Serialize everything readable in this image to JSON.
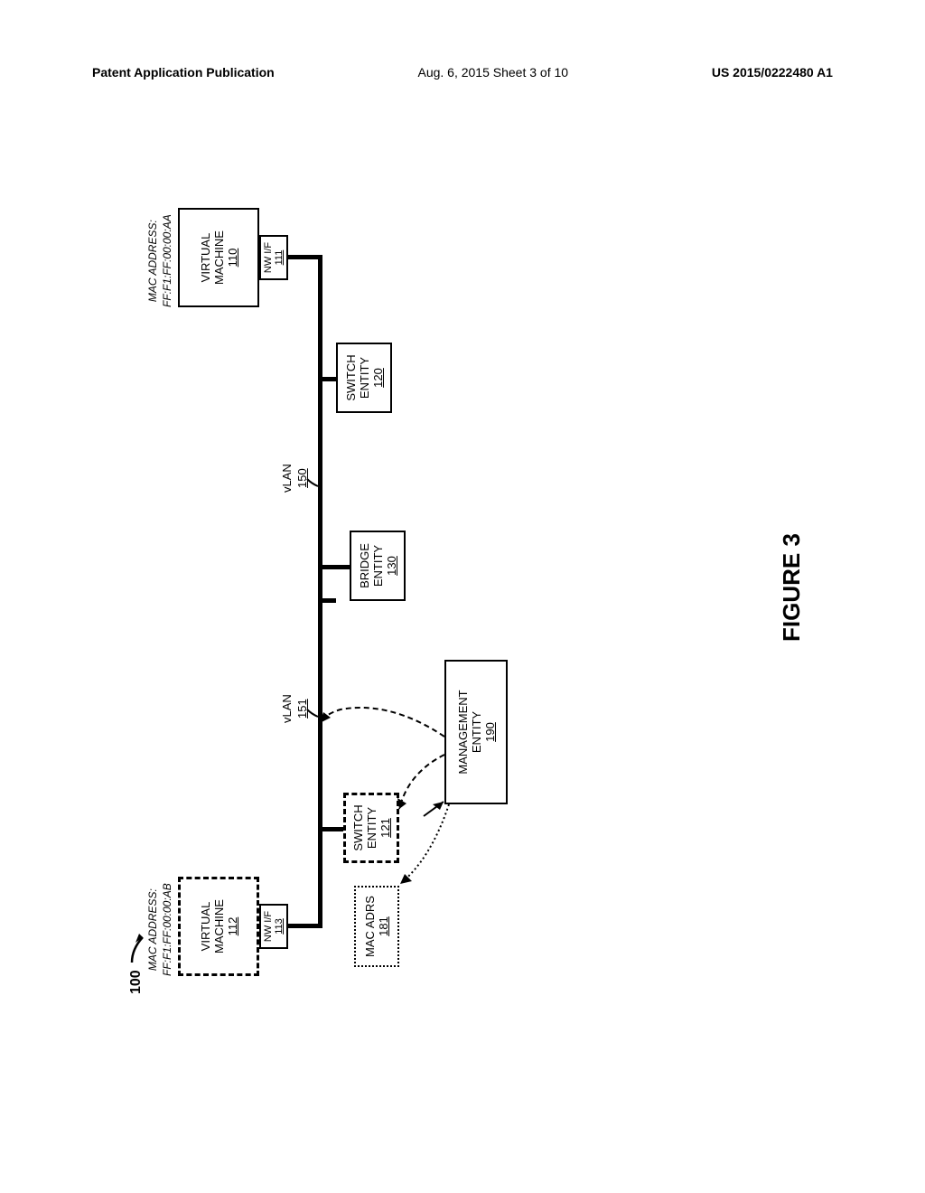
{
  "header": {
    "left": "Patent Application Publication",
    "center": "Aug. 6, 2015  Sheet 3 of 10",
    "right": "US 2015/0222480 A1"
  },
  "diagram": {
    "ref_num": "100",
    "vm_right": {
      "mac_label": "MAC ADDRESS:",
      "mac_value": "FF:F1:FF:00:00:AA",
      "title": "VIRTUAL",
      "subtitle": "MACHINE",
      "ref": "110",
      "nwif_label": "NW I/F",
      "nwif_ref": "111"
    },
    "vm_left": {
      "mac_label": "MAC ADDRESS:",
      "mac_value": "FF:F1:FF:00:00:AB",
      "title": "VIRTUAL",
      "subtitle": "MACHINE",
      "ref": "112",
      "nwif_label": "NW I/F",
      "nwif_ref": "113"
    },
    "switch_right": {
      "title": "SWITCH",
      "subtitle": "ENTITY",
      "ref": "120"
    },
    "switch_left": {
      "title": "SWITCH",
      "subtitle": "ENTITY",
      "ref": "121"
    },
    "bridge": {
      "title": "BRIDGE",
      "subtitle": "ENTITY",
      "ref": "130"
    },
    "vlan_right": {
      "label": "vLAN",
      "ref": "150"
    },
    "vlan_left": {
      "label": "vLAN",
      "ref": "151"
    },
    "mac_adrs": {
      "label": "MAC ADRS",
      "ref": "181"
    },
    "management": {
      "title": "MANAGEMENT",
      "subtitle": "ENTITY",
      "ref": "190"
    },
    "figure_caption": "FIGURE 3"
  }
}
